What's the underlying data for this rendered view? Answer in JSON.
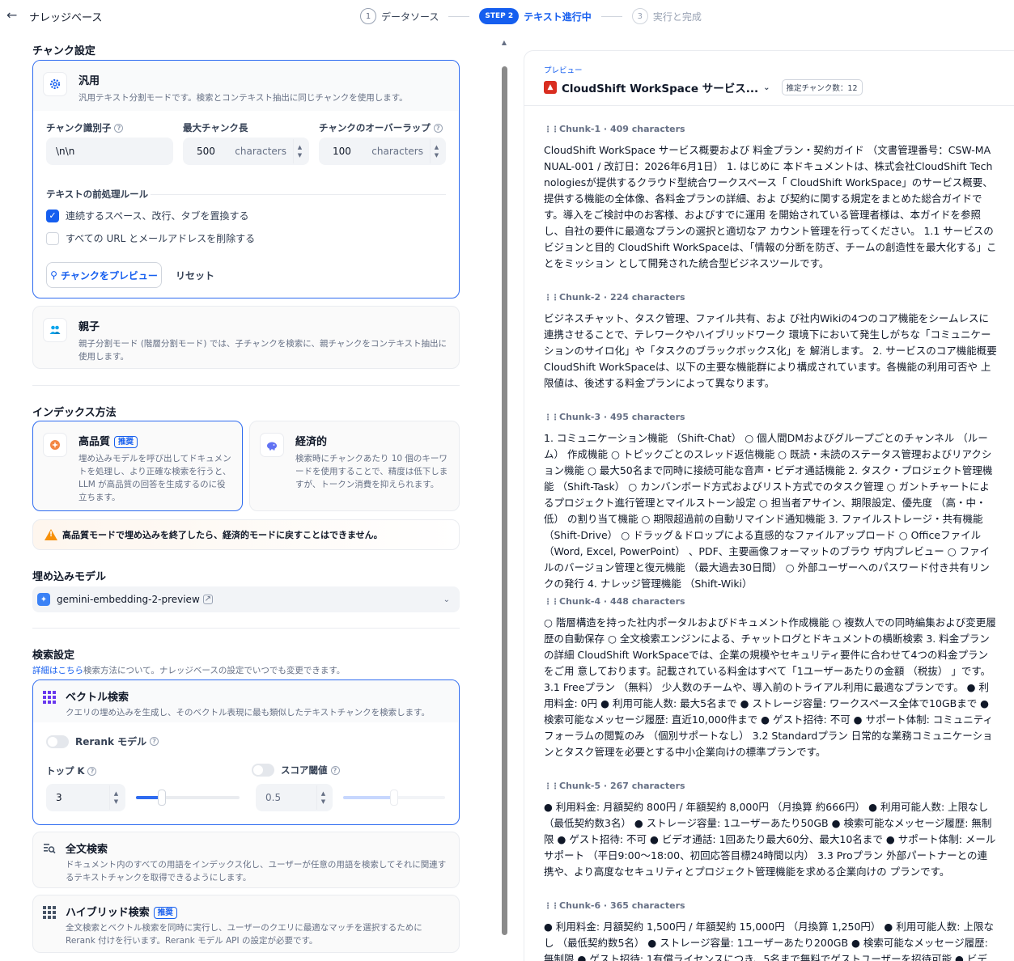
{
  "header": {
    "back_icon": "arrow-left-icon",
    "title": "ナレッジベース",
    "steps": [
      {
        "num": "1",
        "label": "データソース"
      },
      {
        "badge": "STEP 2",
        "label": "テキスト進行中"
      },
      {
        "num": "3",
        "label": "実行と完成"
      }
    ]
  },
  "chunk_settings": {
    "section_title": "チャンク設定",
    "general": {
      "name": "汎用",
      "desc": "汎用テキスト分割モードです。検索とコンテキスト抽出に同じチャンクを使用します。",
      "delimiter_label": "チャンク識別子",
      "delimiter_value": "\\n\\n",
      "max_len_label": "最大チャンク長",
      "max_len_value": "500",
      "overlap_label": "チャンクのオーバーラップ",
      "overlap_value": "100",
      "unit": "characters",
      "preprocess_label": "テキストの前処理ルール",
      "rule1": "連続するスペース、改行、タブを置換する",
      "rule1_checked": true,
      "rule2": "すべての URL とメールアドレスを削除する",
      "rule2_checked": false,
      "preview_button": "チャンクをプレビュー",
      "reset_button": "リセット"
    },
    "parent_child": {
      "name": "親子",
      "desc": "親子分割モード (階層分割モード) では、子チャンクを検索に、親チャンクをコンテキスト抽出に使用します。"
    }
  },
  "index_method": {
    "section_title": "インデックス方法",
    "high_quality": {
      "name": "高品質",
      "badge": "推奨",
      "desc": "埋め込みモデルを呼び出してドキュメントを処理し、より正確な検索を行うと、LLM が高品質の回答を生成するのに役立ちます。"
    },
    "economy": {
      "name": "経済的",
      "desc": "検索時にチャンクあたり 10 個のキーワードを使用することで、精度は低下しますが、トークン消費を抑えられます。"
    },
    "warning": "高品質モードで埋め込みを終了したら、経済的モードに戻すことはできません。"
  },
  "embedding": {
    "section_title": "埋め込みモデル",
    "model": "gemini-embedding-2-preview"
  },
  "retrieval": {
    "section_title": "検索設定",
    "link": "詳細はこちら",
    "note": "検索方法について。ナレッジベースの設定でいつでも変更できます。",
    "vector": {
      "name": "ベクトル検索",
      "desc": "クエリの埋め込みを生成し、そのベクトル表現に最も類似したテキストチャンクを検索します。",
      "rerank_label": "Rerank モデル",
      "topk_label": "トップ K",
      "topk_value": "3",
      "score_label": "スコア閾値",
      "score_value": "0.5",
      "topk_fraction": 0.25,
      "score_fraction": 0.5
    },
    "fulltext": {
      "name": "全文検索",
      "desc": "ドキュメント内のすべての用語をインデックス化し、ユーザーが任意の用語を検索してそれに関連するテキストチャンクを取得できるようにします。"
    },
    "hybrid": {
      "name": "ハイブリッド検索",
      "badge": "推奨",
      "desc": "全文検索とベクトル検索を同時に実行し、ユーザーのクエリに最適なマッチを選択するために Rerank 付けを行います。Rerank モデル API の設定が必要です。"
    }
  },
  "preview": {
    "label": "プレビュー",
    "doc_title": "CloudShift WorkSpace サービス...",
    "estimate": "推定チャンク数：12",
    "chunks": [
      {
        "meta": "Chunk-1 · 409 characters",
        "text": "CloudShift WorkSpace サービス概要および 料金プラン・契約ガイド （文書管理番号：CSW-MANUAL-001 / 改訂日：2026年6月1日） 1. はじめに 本ドキュメントは、株式会社CloudShift Technologiesが提供するクラウド型統合ワークスペース「 CloudShift WorkSpace」のサービス概要、提供する機能の全体像、各料金プランの詳細、およ び契約に関する規定をまとめた総合ガイドです。導入をご検討中のお客様、およびすでに運用 を開始されている管理者様は、本ガイドを参照し、自社の要件に最適なプランの選択と適切なア カウント管理を行ってください。 1.1 サービスのビジョンと目的 CloudShift WorkSpaceは、「情報の分断を防ぎ、チームの創造性を最大化する」ことをミッション として開発された統合型ビジネスツールです。"
      },
      {
        "meta": "Chunk-2 · 224 characters",
        "text": "ビジネスチャット、タスク管理、ファイル共有、およ び社内Wikiの4つのコア機能をシームレスに連携させることで、テレワークやハイブリッドワーク 環境下において発生しがちな「コミュニケーションのサイロ化」や「タスクのブラックボックス化」を 解消します。 2. サービスのコア機能概要 CloudShift WorkSpaceは、以下の主要な機能群により構成されています。各機能の利用可否や 上限値は、後述する料金プランによって異なります。"
      },
      {
        "meta": "Chunk-3 · 495 characters",
        "text": "1. コミュニケーション機能 （Shift-Chat） ○ 個人間DMおよびグループごとのチャンネル （ルーム） 作成機能 ○ トピックごとのスレッド返信機能 ○ 既読・未読のステータス管理およびリアクション機能 ○ 最大50名まで同時に接続可能な音声・ビデオ通話機能 2. タスク・プロジェクト管理機能 （Shift-Task） ○ カンバンボード方式およびリスト方式でのタスク管理 ○ ガントチャートによるプロジェクト進行管理とマイルストーン設定 ○ 担当者アサイン、期限設定、優先度 （高・中・低） の割り当て機能 ○ 期限超過前の自動リマインド通知機能 3. ファイルストレージ・共有機能 （Shift-Drive） ○ ドラッグ＆ドロップによる直感的なファイルアップロード ○ Officeファイル （Word, Excel, PowerPoint） 、PDF、主要画像フォーマットのブラウ ザ内プレビュー ○ ファイルのバージョン管理と復元機能 （最大過去30日間） ○ 外部ユーザーへのパスワード付き共有リンクの発行 4. ナレッジ管理機能 （Shift-Wiki）"
      },
      {
        "meta": "Chunk-4 · 448 characters",
        "text": "○ 階層構造を持った社内ポータルおよびドキュメント作成機能 ○ 複数人での同時編集および変更履歴の自動保存 ○ 全文検索エンジンによる、チャットログとドキュメントの横断検索 3. 料金プランの詳細 CloudShift WorkSpaceでは、企業の規模やセキュリティ要件に合わせて4つの料金プランをご用 意しております。記載されている料金はすべて「1ユーザーあたりの金額 （税抜） 」です。 3.1 Freeプラン （無料） 少人数のチームや、導入前のトライアル利用に最適なプランです。 ● 利用料金: 0円 ● 利用可能人数: 最大5名まで ● ストレージ容量: ワークスペース全体で10GBまで ● 検索可能なメッセージ履歴: 直近10,000件まで ● ゲスト招待: 不可 ● サポート体制: コミュニティフォーラムの閲覧のみ （個別サポートなし） 3.2 Standardプラン 日常的な業務コミュニケーションとタスク管理を必要とする中小企業向けの標準プランです。"
      },
      {
        "meta": "Chunk-5 · 267 characters",
        "text": "● 利用料金: 月額契約 800円 / 年額契約 8,000円 （月換算 約666円） ● 利用可能人数: 上限なし （最低契約数3名） ● ストレージ容量: 1ユーザーあたり50GB ● 検索可能なメッセージ履歴: 無制限 ● ゲスト招待: 不可 ● ビデオ通話: 1回あたり最大60分、最大10名まで ● サポート体制: メールサポート （平日9:00〜18:00、初回応答目標24時間以内） 3.3 Proプラン 外部パートナーとの連携や、より高度なセキュリティとプロジェクト管理機能を求める企業向けの プランです。"
      },
      {
        "meta": "Chunk-6 · 365 characters",
        "text": "● 利用料金: 月額契約 1,500円 / 年額契約 15,000円 （月換算 1,250円） ● 利用可能人数: 上限なし （最低契約数5名） ● ストレージ容量: 1ユーザーあたり200GB ● 検索可能なメッセージ履歴: 無制限 ● ゲスト招待: 1有償ライセンスにつき、5名まで無料でゲストユーザーを招待可能 ● ビデオ"
      }
    ]
  }
}
